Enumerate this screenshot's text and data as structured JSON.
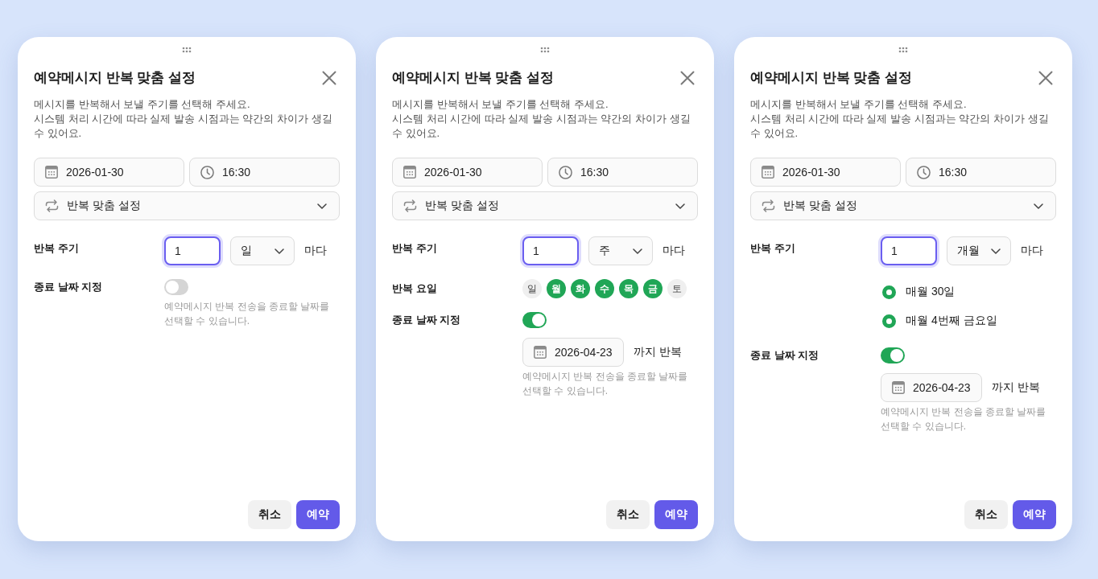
{
  "dialogs": [
    {
      "title": "예약메시지 반복 맞춤 설정",
      "description": [
        "메시지를 반복해서 보낼 주기를 선택해 주세요.",
        "시스템 처리 시간에 따라 실제 발송 시점과는 약간의 차이가 생길 수 있어요."
      ],
      "date": "2026-01-30",
      "time": "16:30",
      "repeat_select": "반복 맞춤 설정",
      "interval": {
        "label": "반복 주기",
        "value": "1",
        "focused": true,
        "unit": "일",
        "suffix": "마다"
      },
      "end_date": {
        "label": "종료 날짜 지정",
        "on": false,
        "help": "예약메시지 반복 전송을 종료할 날짜를 선택할 수 있습니다."
      },
      "buttons": [
        {
          "label": "취소",
          "kind": "secondary"
        },
        {
          "label": "예약",
          "kind": "primary"
        }
      ]
    },
    {
      "title": "예약메시지 반복 맞춤 설정",
      "description": [
        "메시지를 반복해서 보낼 주기를 선택해 주세요.",
        "시스템 처리 시간에 따라 실제 발송 시점과는 약간의 차이가 생길 수 있어요."
      ],
      "date": "2026-01-30",
      "time": "16:30",
      "repeat_select": "반복 맞춤 설정",
      "interval": {
        "label": "반복 주기",
        "value": "1",
        "focused": true,
        "unit": "주",
        "suffix": "마다"
      },
      "weekdays": {
        "label": "반복 요일",
        "days": [
          {
            "label": "일",
            "selected": false
          },
          {
            "label": "월",
            "selected": true
          },
          {
            "label": "화",
            "selected": true
          },
          {
            "label": "수",
            "selected": true
          },
          {
            "label": "목",
            "selected": true
          },
          {
            "label": "금",
            "selected": true
          },
          {
            "label": "토",
            "selected": false
          }
        ]
      },
      "end_date": {
        "label": "종료 날짜 지정",
        "on": true,
        "date": "2026-04-23",
        "date_suffix": "까지 반복",
        "help": "예약메시지 반복 전송을 종료할 날짜를 선택할 수 있습니다."
      },
      "buttons": [
        {
          "label": "취소",
          "kind": "secondary"
        },
        {
          "label": "예약",
          "kind": "primary"
        }
      ]
    },
    {
      "title": "예약메시지 반복 맞춤 설정",
      "description": [
        "메시지를 반복해서 보낼 주기를 선택해 주세요.",
        "시스템 처리 시간에 따라 실제 발송 시점과는 약간의 차이가 생길 수 있어요."
      ],
      "date": "2026-01-30",
      "time": "16:30",
      "repeat_select": "반복 맞춤 설정",
      "interval": {
        "label": "반복 주기",
        "value": "1",
        "focused": true,
        "unit": "개월",
        "suffix": "마다"
      },
      "monthly_options": [
        {
          "label": "매월 30일",
          "selected": true
        },
        {
          "label": "매월 4번째 금요일",
          "selected": true
        }
      ],
      "end_date": {
        "label": "종료 날짜 지정",
        "on": true,
        "date": "2026-04-23",
        "date_suffix": "까지 반복",
        "help": "예약메시지 반복 전송을 종료할 날짜를 선택할 수 있습니다."
      },
      "buttons": [
        {
          "label": "취소",
          "kind": "secondary"
        },
        {
          "label": "예약",
          "kind": "primary"
        }
      ]
    }
  ]
}
